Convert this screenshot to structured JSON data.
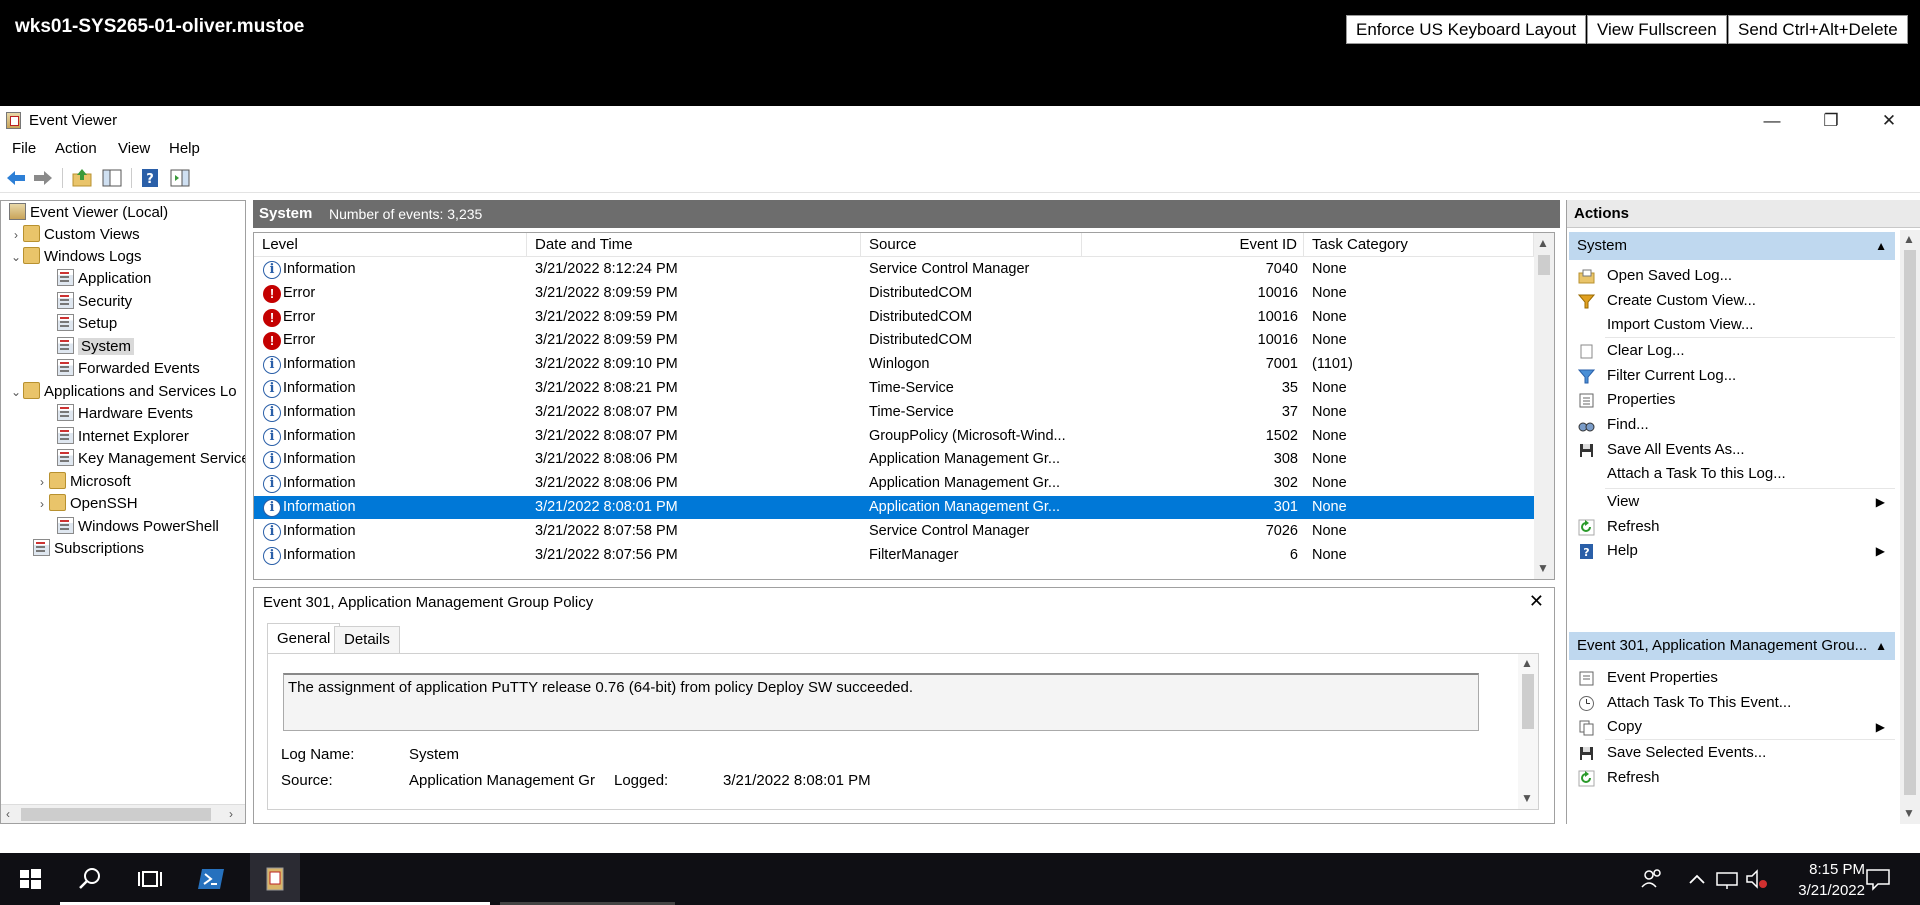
{
  "remote": {
    "title": "wks01-SYS265-01-oliver.mustoe",
    "buttons": [
      "Enforce US Keyboard Layout",
      "View Fullscreen",
      "Send Ctrl+Alt+Delete"
    ]
  },
  "window": {
    "title": "Event Viewer",
    "controls": {
      "minimize": "—",
      "restore": "❐",
      "close": "✕"
    }
  },
  "menu": [
    "File",
    "Action",
    "View",
    "Help"
  ],
  "tree": {
    "root": "Event Viewer (Local)",
    "custom_views": "Custom Views",
    "windows_logs": "Windows Logs",
    "application": "Application",
    "security": "Security",
    "setup": "Setup",
    "system": "System",
    "forwarded": "Forwarded Events",
    "apps_services": "Applications and Services Lo",
    "hardware": "Hardware Events",
    "ie": "Internet Explorer",
    "kms": "Key Management Service",
    "microsoft": "Microsoft",
    "openssh": "OpenSSH",
    "powershell": "Windows PowerShell",
    "subscriptions": "Subscriptions"
  },
  "log": {
    "name": "System",
    "count_text": "Number of events: 3,235"
  },
  "columns": {
    "level": "Level",
    "date": "Date and Time",
    "source": "Source",
    "event_id": "Event ID",
    "task": "Task Category"
  },
  "events": [
    {
      "level": "Information",
      "date": "3/21/2022 8:12:24 PM",
      "source": "Service Control Manager",
      "id": "7040",
      "task": "None"
    },
    {
      "level": "Error",
      "date": "3/21/2022 8:09:59 PM",
      "source": "DistributedCOM",
      "id": "10016",
      "task": "None"
    },
    {
      "level": "Error",
      "date": "3/21/2022 8:09:59 PM",
      "source": "DistributedCOM",
      "id": "10016",
      "task": "None"
    },
    {
      "level": "Error",
      "date": "3/21/2022 8:09:59 PM",
      "source": "DistributedCOM",
      "id": "10016",
      "task": "None"
    },
    {
      "level": "Information",
      "date": "3/21/2022 8:09:10 PM",
      "source": "Winlogon",
      "id": "7001",
      "task": "(1101)"
    },
    {
      "level": "Information",
      "date": "3/21/2022 8:08:21 PM",
      "source": "Time-Service",
      "id": "35",
      "task": "None"
    },
    {
      "level": "Information",
      "date": "3/21/2022 8:08:07 PM",
      "source": "Time-Service",
      "id": "37",
      "task": "None"
    },
    {
      "level": "Information",
      "date": "3/21/2022 8:08:07 PM",
      "source": "GroupPolicy (Microsoft-Wind...",
      "id": "1502",
      "task": "None"
    },
    {
      "level": "Information",
      "date": "3/21/2022 8:08:06 PM",
      "source": "Application Management Gr...",
      "id": "308",
      "task": "None"
    },
    {
      "level": "Information",
      "date": "3/21/2022 8:08:06 PM",
      "source": "Application Management Gr...",
      "id": "302",
      "task": "None"
    },
    {
      "level": "Information",
      "date": "3/21/2022 8:08:01 PM",
      "source": "Application Management Gr...",
      "id": "301",
      "task": "None"
    },
    {
      "level": "Information",
      "date": "3/21/2022 8:07:58 PM",
      "source": "Service Control Manager",
      "id": "7026",
      "task": "None"
    },
    {
      "level": "Information",
      "date": "3/21/2022 8:07:56 PM",
      "source": "FilterManager",
      "id": "6",
      "task": "None"
    }
  ],
  "selected_index": 10,
  "detail": {
    "title": "Event 301, Application Management Group Policy",
    "close": "✕",
    "tab_general": "General",
    "tab_details": "Details",
    "message": "The assignment of application PuTTY release 0.76 (64-bit) from policy Deploy SW succeeded.",
    "log_name_label": "Log Name:",
    "log_name_value": "System",
    "source_label": "Source:",
    "source_value": "Application Management Gr",
    "logged_label": "Logged:",
    "logged_value": "3/21/2022 8:08:01 PM"
  },
  "actions": {
    "header": "Actions",
    "section1": "System",
    "items1": [
      "Open Saved Log...",
      "Create Custom View...",
      "Import Custom View...",
      "Clear Log...",
      "Filter Current Log...",
      "Properties",
      "Find...",
      "Save All Events As...",
      "Attach a Task To this Log...",
      "View",
      "Refresh",
      "Help"
    ],
    "section2": "Event 301, Application Management Grou...",
    "items2": [
      "Event Properties",
      "Attach Task To This Event...",
      "Copy",
      "Save Selected Events...",
      "Refresh"
    ]
  },
  "taskbar": {
    "time": "8:15 PM",
    "date": "3/21/2022"
  },
  "colors": {
    "selection": "#0078d7",
    "section_bg": "#bfd8ef",
    "header_bg": "#6d6d6d",
    "error": "#c40000",
    "taskbar": "#0f0f14"
  }
}
